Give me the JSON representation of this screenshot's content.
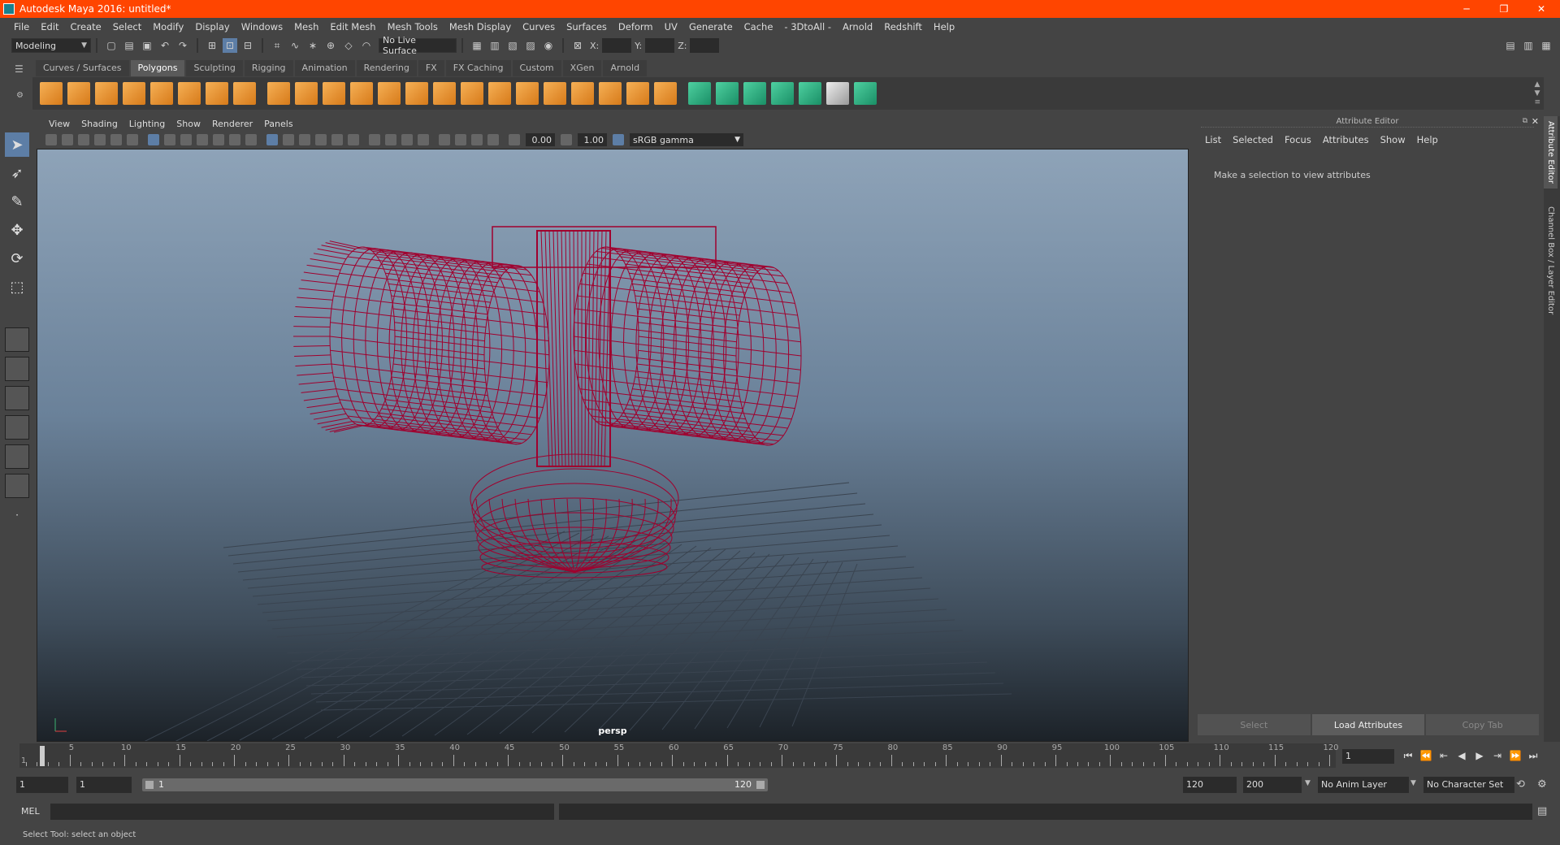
{
  "window": {
    "title": "Autodesk Maya 2016: untitled*"
  },
  "menubar": [
    "File",
    "Edit",
    "Create",
    "Select",
    "Modify",
    "Display",
    "Windows",
    "Mesh",
    "Edit Mesh",
    "Mesh Tools",
    "Mesh Display",
    "Curves",
    "Surfaces",
    "Deform",
    "UV",
    "Generate",
    "Cache",
    "- 3DtoAll -",
    "Arnold",
    "Redshift",
    "Help"
  ],
  "statusline": {
    "mode": "Modeling",
    "live_surface": "No Live Surface",
    "x_label": "X:",
    "y_label": "Y:",
    "z_label": "Z:"
  },
  "shelf_tabs": [
    "Curves / Surfaces",
    "Polygons",
    "Sculpting",
    "Rigging",
    "Animation",
    "Rendering",
    "FX",
    "FX Caching",
    "Custom",
    "XGen",
    "Arnold"
  ],
  "shelf_active": "Polygons",
  "viewport": {
    "menu": [
      "View",
      "Shading",
      "Lighting",
      "Show",
      "Renderer",
      "Panels"
    ],
    "exposure": "0.00",
    "gamma": "1.00",
    "color_space": "sRGB gamma",
    "camera": "persp",
    "wire_color": "#a0002e"
  },
  "attribute_editor": {
    "header": "Attribute Editor",
    "menu": [
      "List",
      "Selected",
      "Focus",
      "Attributes",
      "Show",
      "Help"
    ],
    "message": "Make a selection to view attributes",
    "buttons": {
      "select": "Select",
      "load": "Load Attributes",
      "copy": "Copy Tab"
    }
  },
  "side_tabs": [
    "Attribute Editor",
    "Channel Box / Layer Editor"
  ],
  "timeline": {
    "ticks": [
      "5",
      "10",
      "15",
      "20",
      "25",
      "30",
      "35",
      "40",
      "45",
      "50",
      "55",
      "60",
      "65",
      "70",
      "75",
      "80",
      "85",
      "90",
      "95",
      "100",
      "105",
      "110",
      "115",
      "120"
    ],
    "start_label": "1",
    "current_frame": "1"
  },
  "range": {
    "start": "1",
    "playback_start": "1",
    "bar_start": "1",
    "bar_end": "120",
    "playback_end": "120",
    "end": "200",
    "anim_layer": "No Anim Layer",
    "character_set": "No Character Set"
  },
  "cmdline": {
    "label": "MEL"
  },
  "helpline": {
    "text": "Select Tool: select an object"
  }
}
